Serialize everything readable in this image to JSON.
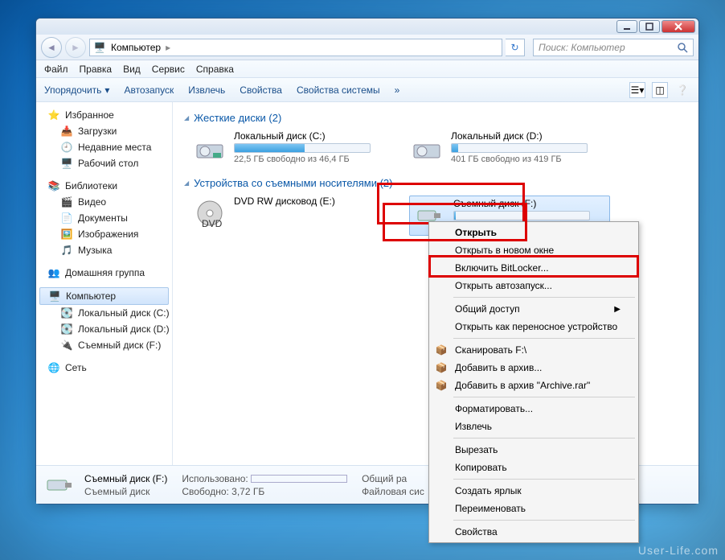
{
  "title": {
    "computer": "Компьютер"
  },
  "search": {
    "placeholder": "Поиск: Компьютер"
  },
  "menubar": {
    "file": "Файл",
    "edit": "Правка",
    "view": "Вид",
    "service": "Сервис",
    "help": "Справка"
  },
  "toolbar": {
    "organize": "Упорядочить",
    "autostart": "Автозапуск",
    "eject": "Извлечь",
    "properties": "Свойства",
    "sysproperties": "Свойства системы",
    "more": "»"
  },
  "sidebar": {
    "favorites": "Избранное",
    "downloads": "Загрузки",
    "recent": "Недавние места",
    "desktop": "Рабочий стол",
    "libraries": "Библиотеки",
    "videos": "Видео",
    "documents": "Документы",
    "pictures": "Изображения",
    "music": "Музыка",
    "homegroup": "Домашняя группа",
    "computer": "Компьютер",
    "localc": "Локальный диск (C:)",
    "locald": "Локальный диск (D:)",
    "removf": "Съемный диск (F:)",
    "network": "Сеть"
  },
  "cat": {
    "hdd": "Жесткие диски (2)",
    "removable": "Устройства со съемными носителями (2)"
  },
  "drives": {
    "c": {
      "name": "Локальный диск (C:)",
      "sub": "22,5 ГБ свободно из 46,4 ГБ",
      "fill": 52
    },
    "d": {
      "name": "Локальный диск (D:)",
      "sub": "401 ГБ свободно из 419 ГБ",
      "fill": 5
    },
    "dvd": {
      "name": "DVD RW дисковод (E:)"
    },
    "f": {
      "name": "Съемный диск (F:)"
    }
  },
  "status": {
    "title": "Съемный диск (F:)",
    "type": "Съемный диск",
    "used_lbl": "Использовано:",
    "free_lbl": "Свободно:",
    "free_val": "3,72 ГБ",
    "total_lbl": "Общий ра",
    "fs_lbl": "Файловая сис"
  },
  "ctx": {
    "open": "Открыть",
    "opennew": "Открыть в новом окне",
    "bitlocker": "Включить BitLocker...",
    "autorun": "Открыть автозапуск...",
    "share": "Общий доступ",
    "portable": "Открыть как переносное устройство",
    "scan": "Сканировать F:\\",
    "addarchive": "Добавить в архив...",
    "addarchive2": "Добавить в архив \"Archive.rar\"",
    "format": "Форматировать...",
    "eject": "Извлечь",
    "cut": "Вырезать",
    "copy": "Копировать",
    "shortcut": "Создать ярлык",
    "rename": "Переименовать",
    "props": "Свойства"
  },
  "watermark": "User-Life.com"
}
